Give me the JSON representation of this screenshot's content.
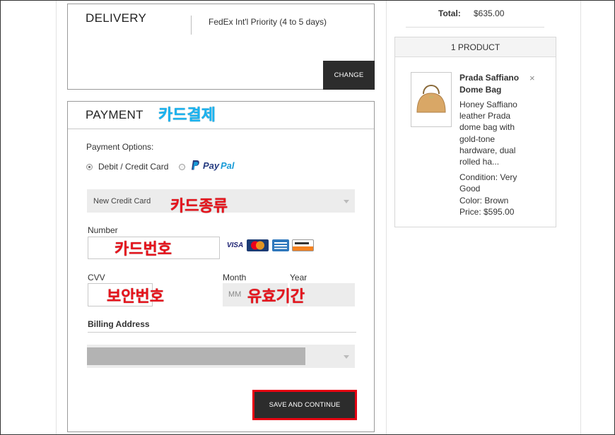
{
  "delivery": {
    "title": "DELIVERY",
    "method": "FedEx Int'l Priority (4 to 5 days)",
    "change_label": "CHANGE"
  },
  "payment": {
    "title": "PAYMENT",
    "annotation": "카드결제",
    "options_label": "Payment Options:",
    "option_card": "Debit / Credit Card",
    "option_paypal_pay": "Pay",
    "option_paypal_pal": "Pal",
    "card_type_value": "New Credit Card",
    "card_type_annotation": "카드종류",
    "number_label": "Number",
    "number_annotation": "카드번호",
    "cvv_label": "CVV",
    "cvv_annotation": "보안번호",
    "month_label": "Month",
    "year_label": "Year",
    "month_placeholder": "MM",
    "expiry_annotation": "유효기간",
    "billing_label": "Billing Address",
    "save_label": "SAVE AND CONTINUE",
    "cards": [
      {
        "name": "VISA",
        "color": "#1a1f71"
      },
      {
        "name": "MasterCard",
        "color": "#eb001b"
      },
      {
        "name": "AMEX",
        "color": "#2e77bc"
      },
      {
        "name": "DISCOVER",
        "color": "#f58220"
      }
    ]
  },
  "summary": {
    "total_label": "Total:",
    "total_value": "$635.00",
    "product_count": "1 PRODUCT",
    "product": {
      "name": "Prada Saffiano Dome Bag",
      "description": "Honey Saffiano leather Prada dome bag with gold-tone hardware, dual rolled ha...",
      "condition": "Condition: Very Good",
      "color": "Color: Brown",
      "price": "Price: $595.00",
      "remove_symbol": "×"
    }
  },
  "colors": {
    "button_dark": "#2c2c2c",
    "highlight_red": "#e60012",
    "annotation_blue": "#18b4f2",
    "annotation_red": "#e8131c"
  }
}
